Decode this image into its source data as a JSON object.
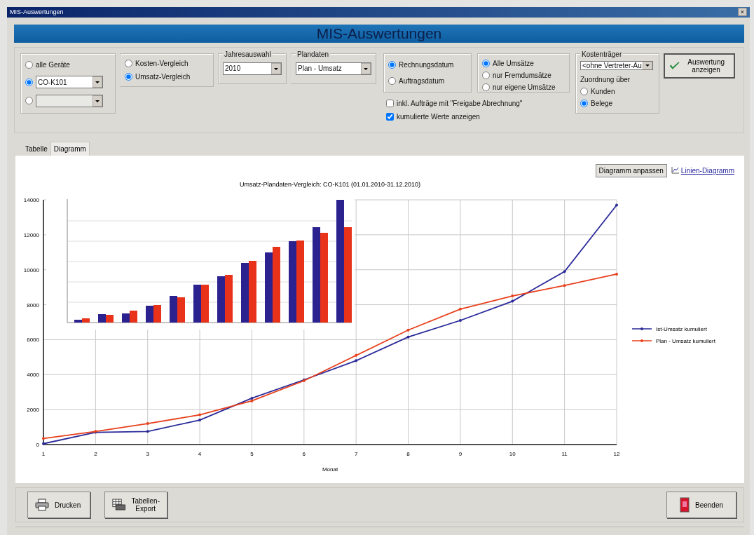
{
  "window": {
    "title": "MIS-Auswertungen",
    "close": "×"
  },
  "header": "MIS-Auswertungen",
  "device_filter": [
    {
      "kind": "label",
      "label": "alle Geräte",
      "selected": false
    },
    {
      "kind": "combo",
      "value": "CO-K101",
      "selected": true
    },
    {
      "kind": "disabled_combo",
      "selected": false
    }
  ],
  "comparison": [
    {
      "label": "Kosten-Vergleich",
      "selected": false
    },
    {
      "label": "Umsatz-Vergleich",
      "selected": true
    }
  ],
  "year": {
    "label": "Jahresauswahl",
    "value": "2010"
  },
  "plan_data": {
    "label": "Plandaten",
    "value": "Plan - Umsatz"
  },
  "date_basis": [
    {
      "label": "Rechnungsdatum",
      "selected": true
    },
    {
      "label": "Auftragsdatum",
      "selected": false
    }
  ],
  "revenue_scope": [
    {
      "label": "Alle Umsätze",
      "selected": true
    },
    {
      "label": "nur Fremdumsätze",
      "selected": false
    },
    {
      "label": "nur eigene Umsätze",
      "selected": false
    }
  ],
  "option_checks": [
    {
      "label": "inkl. Aufträge mit \"Freigabe Abrechnung\"",
      "checked": false
    },
    {
      "label": "kumulierte Werte anzeigen",
      "checked": true
    }
  ],
  "cost_unit": {
    "label": "Kostenträger",
    "value": "<ohne Vertreter-Au",
    "assignment_label": "Zuordnung über",
    "assignment": [
      {
        "label": "Kunden",
        "selected": false
      },
      {
        "label": "Belege",
        "selected": true
      }
    ]
  },
  "show_button": "Auswertung anzeigen",
  "tabs": [
    {
      "label": "Tabelle",
      "selected": false
    },
    {
      "label": "Diagramm",
      "selected": true
    }
  ],
  "adjust_button": "Diagramm anpassen",
  "chart_type_link": "Linien-Diagramm",
  "chart": {
    "chart_data": {
      "type": "line",
      "title": "Umsatz-Plandaten-Vergleich: CO-K101 (01.01.2010-31.12.2010)",
      "xlabel": "Monat",
      "grid": true,
      "legend": true,
      "x": [
        1,
        2,
        3,
        4,
        5,
        6,
        7,
        8,
        9,
        10,
        11,
        12
      ],
      "xlim": [
        1,
        12
      ],
      "ylim": [
        0,
        14000
      ],
      "xticks": [
        1,
        2,
        3,
        4,
        5,
        6,
        7,
        8,
        9,
        10,
        11,
        12
      ],
      "yticks": [
        0,
        2000,
        4000,
        6000,
        8000,
        10000,
        12000,
        14000
      ],
      "series": [
        {
          "name": "Ist-Umsatz kumuliert",
          "color": "#2a2a9a",
          "values": [
            50,
            700,
            750,
            1400,
            2650,
            3700,
            4800,
            6150,
            7100,
            8200,
            9900,
            13700
          ]
        },
        {
          "name": "Plan - Umsatz kumuliert",
          "color": "#e8401c",
          "values": [
            350,
            750,
            1200,
            1700,
            2500,
            3650,
            5100,
            6550,
            7750,
            8500,
            9100,
            9750
          ]
        }
      ]
    }
  },
  "footer_buttons": [
    {
      "kind": "print",
      "label": "Drucken"
    },
    {
      "kind": "export",
      "label": "Tabellen-Export"
    },
    {
      "kind": "exit",
      "label": "Beenden"
    }
  ]
}
